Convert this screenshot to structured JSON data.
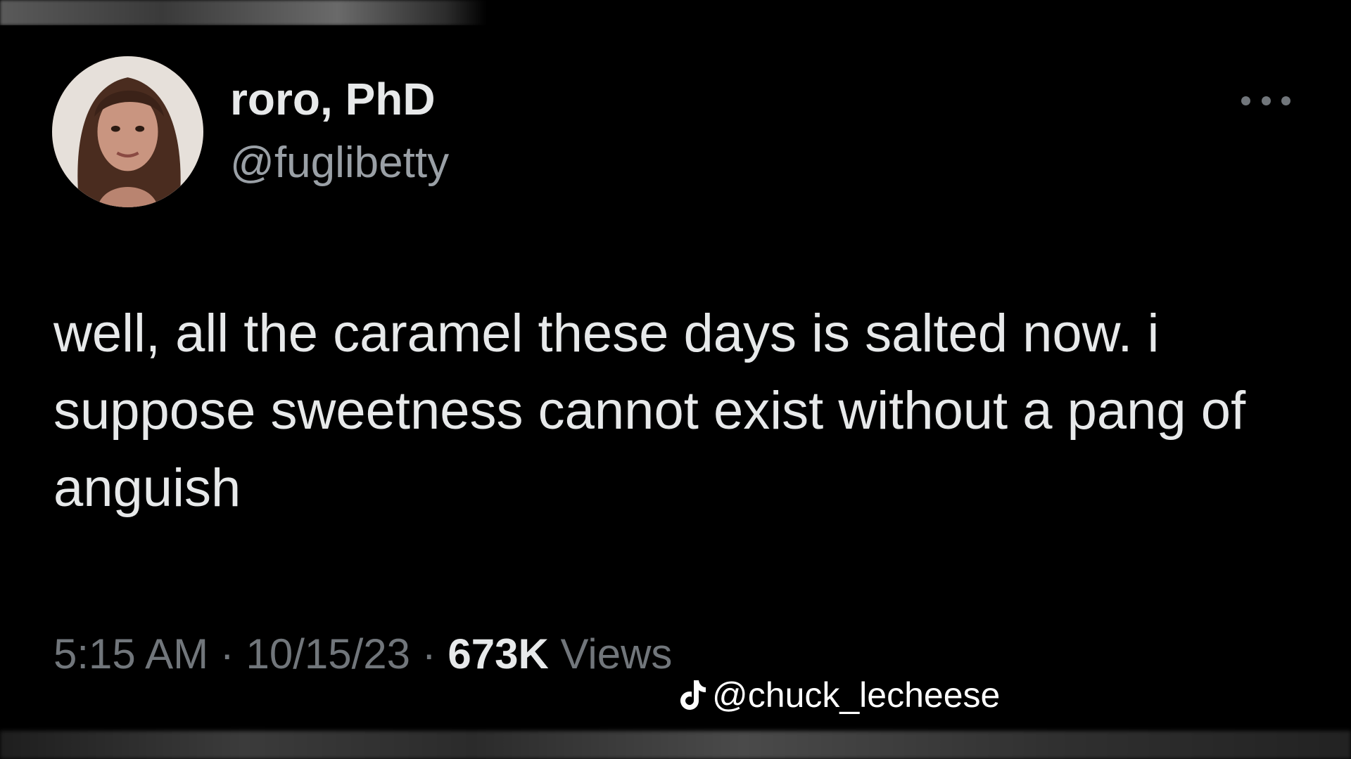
{
  "author": {
    "display_name": "roro, PhD",
    "handle": "@fuglibetty"
  },
  "tweet": {
    "text": "well, all the caramel these days is salted now. i suppose sweetness cannot exist without a pang of anguish"
  },
  "meta": {
    "time": "5:15 AM",
    "separator": " · ",
    "date": "10/15/23",
    "views_count": "673K",
    "views_label": " Views"
  },
  "watermark": {
    "icon": "tiktok-icon",
    "text": "@chuck_lecheese"
  },
  "icons": {
    "more": "more-options-icon"
  },
  "colors": {
    "background": "#000000",
    "primary_text": "#e7e9ea",
    "secondary_text": "#71767b"
  }
}
